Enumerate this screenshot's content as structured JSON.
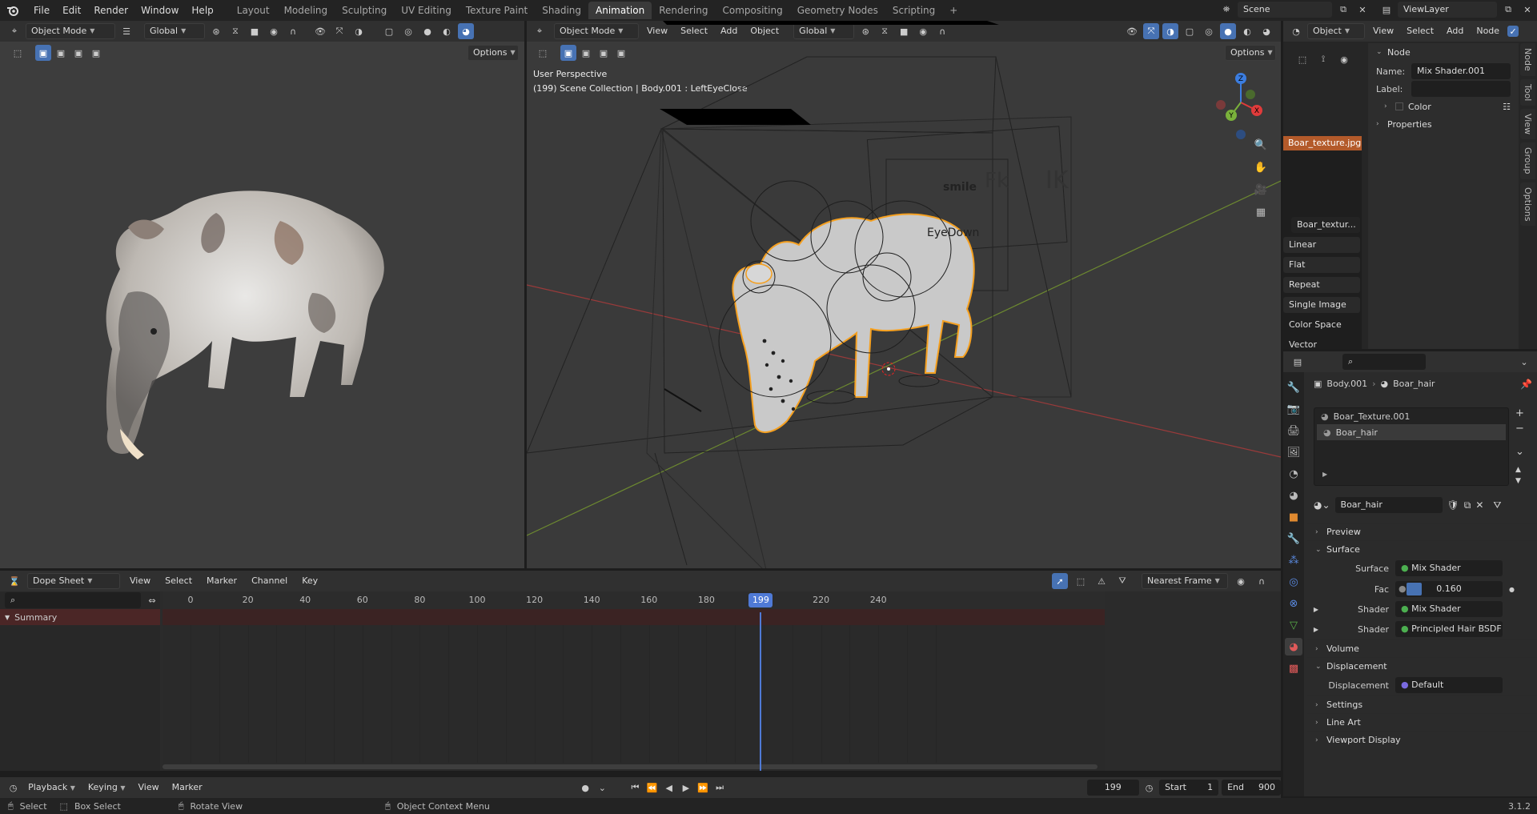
{
  "menu": {
    "file": "File",
    "edit": "Edit",
    "render": "Render",
    "window": "Window",
    "help": "Help"
  },
  "workspaces": [
    "Layout",
    "Modeling",
    "Sculpting",
    "UV Editing",
    "Texture Paint",
    "Shading",
    "Animation",
    "Rendering",
    "Compositing",
    "Geometry Nodes",
    "Scripting"
  ],
  "active_workspace_index": 6,
  "top_right": {
    "scene": "Scene",
    "view_layer": "ViewLayer"
  },
  "viewport_left": {
    "mode": "Object Mode",
    "orientation": "Global",
    "options": "Options"
  },
  "viewport_main": {
    "mode": "Object Mode",
    "menus": [
      "View",
      "Select",
      "Add",
      "Object"
    ],
    "orientation": "Global",
    "options": "Options",
    "overlay_title": "User Perspective",
    "overlay_sub": "(199) Scene Collection | Body.001 : LeftEyeClose",
    "rig_labels": {
      "smile": "smile",
      "fk": "Fk",
      "ik": "IK",
      "eye_down": "EyeDown"
    }
  },
  "node_editor": {
    "mode": "Object",
    "menus": [
      "View",
      "Select",
      "Add",
      "Node"
    ],
    "texture_node": "Boar_texture.jpg",
    "image_label": "Boar_textur...",
    "props": [
      "Linear",
      "Flat",
      "Repeat",
      "Single Image",
      "Color Space",
      "Vector"
    ],
    "side": {
      "header": "Node",
      "name_label": "Name:",
      "name_value": "Mix Shader.001",
      "label_label": "Label:",
      "color": "Color",
      "properties": "Properties"
    },
    "vtabs": [
      "Node",
      "Tool",
      "View",
      "Group",
      "Options"
    ]
  },
  "properties": {
    "breadcrumb_obj": "Body.001",
    "breadcrumb_mat": "Boar_hair",
    "materials": [
      "Boar_Texture.001",
      "Boar_hair"
    ],
    "material_name": "Boar_hair",
    "sections": {
      "preview": "Preview",
      "surface": "Surface",
      "volume": "Volume",
      "displacement": "Displacement",
      "settings": "Settings",
      "line_art": "Line Art",
      "viewport_display": "Viewport Display"
    },
    "surface_label": "Surface",
    "surface_value": "Mix Shader",
    "fac_label": "Fac",
    "fac_value": "0.160",
    "fac_fraction": 0.16,
    "shader1_label": "Shader",
    "shader1_value": "Mix Shader",
    "shader2_label": "Shader",
    "shader2_value": "Principled Hair BSDF",
    "disp_label": "Displacement",
    "disp_value": "Default"
  },
  "dopesheet": {
    "mode": "Dope Sheet",
    "menus": [
      "View",
      "Select",
      "Marker",
      "Channel",
      "Key"
    ],
    "snap": "Nearest Frame",
    "summary": "Summary",
    "ticks": [
      "0",
      "20",
      "40",
      "60",
      "80",
      "100",
      "120",
      "140",
      "160",
      "180",
      "220",
      "240"
    ],
    "current_frame": "199"
  },
  "timeline": {
    "menus": [
      "Playback",
      "Keying",
      "View",
      "Marker"
    ],
    "frame": "199",
    "start_label": "Start",
    "start": "1",
    "end_label": "End",
    "end": "900"
  },
  "statusbar": {
    "select": "Select",
    "box_select": "Box Select",
    "rotate": "Rotate View",
    "context": "Object Context Menu",
    "version": "3.1.2"
  }
}
